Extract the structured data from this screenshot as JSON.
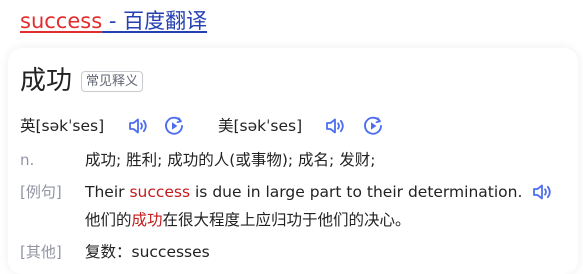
{
  "header": {
    "title_word": "success",
    "title_suffix": " - 百度翻译"
  },
  "entry": {
    "headword": "成功",
    "tag": "常见释义"
  },
  "pronunciations": [
    {
      "label": "英[səkˈses]"
    },
    {
      "label": "美[səkˈses]"
    }
  ],
  "definition": {
    "pos": "n.",
    "text": "成功; 胜利; 成功的人(或事物); 成名; 发财;"
  },
  "example": {
    "label": "[例句]",
    "en_before": "Their ",
    "en_highlight": "success",
    "en_after": " is due in large part to their determination.",
    "zh_before": "他们的",
    "zh_highlight": "成功",
    "zh_after": "在很大程度上应归功于他们的决心。"
  },
  "other": {
    "label": "[其他]",
    "text": "复数：successes"
  },
  "icons": {
    "audio": "speaker-icon",
    "play": "play-circle-icon"
  },
  "colors": {
    "accent_blue": "#4e6ef2",
    "link_blue": "#2440b3",
    "highlight_red": "#e02d2d",
    "label_gray": "#9195a3"
  }
}
